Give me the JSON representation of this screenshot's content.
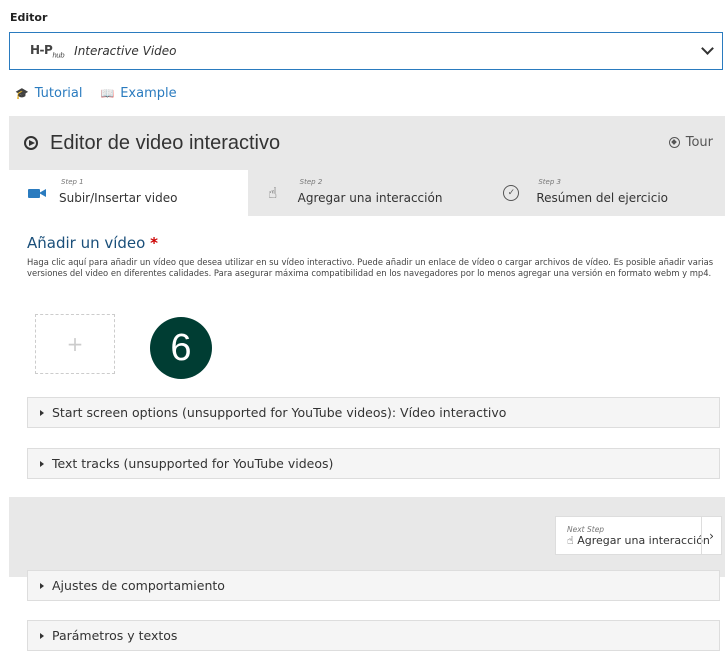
{
  "editor_label": "Editor",
  "selector": {
    "logo_main": "H-P",
    "logo_sub": "hub",
    "title": "Interactive Video"
  },
  "links": {
    "tutorial": "Tutorial",
    "example": "Example"
  },
  "panel": {
    "title": "Editor de video interactivo",
    "tour": "Tour"
  },
  "steps": [
    {
      "num": "Step 1",
      "label": "Subir/Insertar video"
    },
    {
      "num": "Step 2",
      "label": "Agregar una interacción"
    },
    {
      "num": "Step 3",
      "label": "Resúmen del ejercicio"
    }
  ],
  "add_video": {
    "title": "Añadir un vídeo",
    "required": "*",
    "description": "Haga clic aquí para añadir un vídeo que desea utilizar en su vídeo interactivo. Puede añadir un enlace de vídeo o cargar archivos de vídeo. Es posible añadir varias versiones del video en diferentes calidades. Para asegurar máxima compatibilidad en los navegadores por lo menos agregar una versión en formato webm y mp4.",
    "plus": "+"
  },
  "badge": "6",
  "sections": {
    "start_screen": "Start screen options (unsupported for YouTube videos): Vídeo interactivo",
    "text_tracks": "Text tracks (unsupported for YouTube videos)",
    "behaviour": "Ajustes de comportamiento",
    "params": "Parámetros y textos"
  },
  "next_step": {
    "small": "Next Step",
    "label": "Agregar una interacción",
    "arrow": "›"
  }
}
